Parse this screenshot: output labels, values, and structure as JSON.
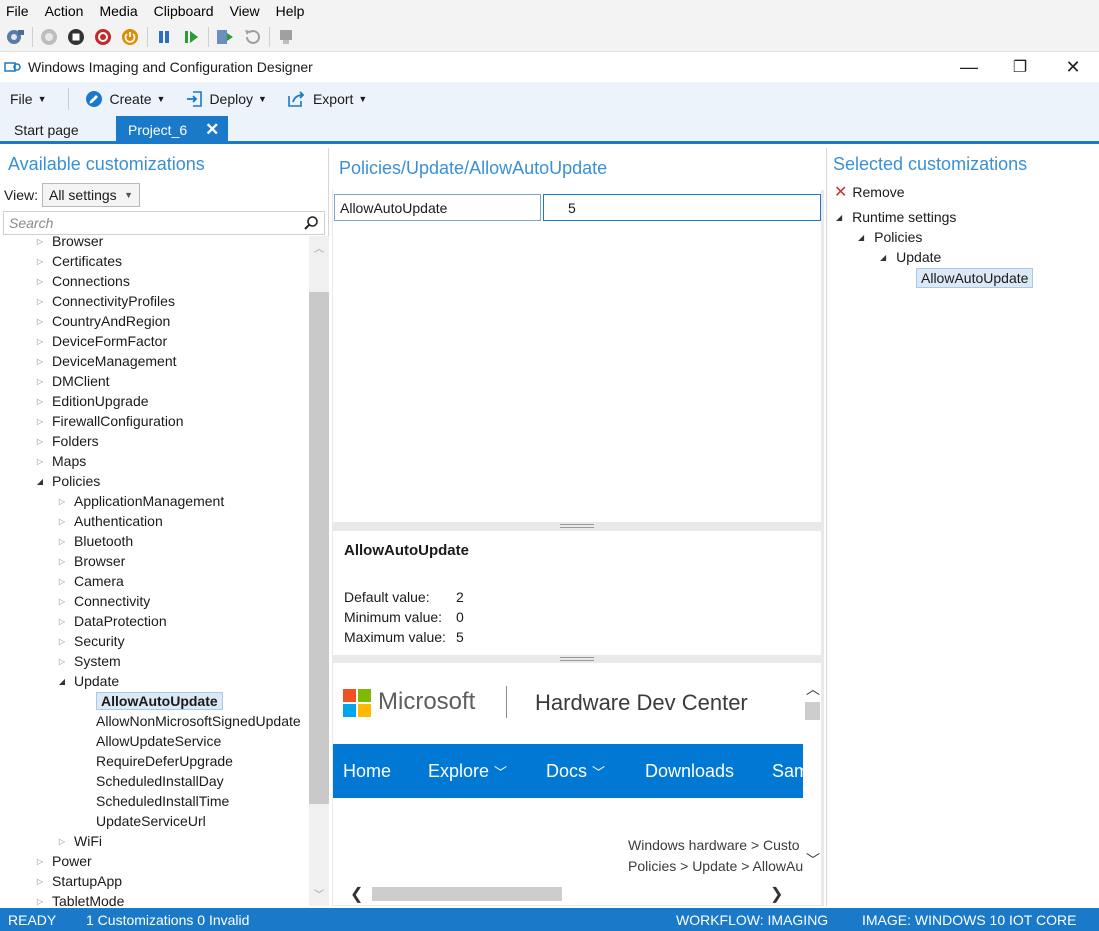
{
  "host": {
    "menu": [
      "File",
      "Action",
      "Media",
      "Clipboard",
      "View",
      "Help"
    ],
    "toolbar_icons": [
      "ctrl-alt-del-icon",
      "start-icon",
      "stop-icon",
      "shutdown-icon",
      "power-icon",
      "pause-icon",
      "resume-icon",
      "checkpoint-icon",
      "revert-icon",
      "enhanced-session-icon"
    ]
  },
  "window": {
    "title": "Windows Imaging and Configuration Designer",
    "controls": {
      "minimize": "—",
      "restore": "❐",
      "close": "✕"
    }
  },
  "commands": {
    "file": "File",
    "create": "Create",
    "deploy": "Deploy",
    "export": "Export"
  },
  "tabs": {
    "start": "Start page",
    "project": "Project_6",
    "close": "✕"
  },
  "left": {
    "title": "Available customizations",
    "view_label": "View:",
    "view_value": "All settings",
    "search_placeholder": "Search",
    "tree": [
      {
        "label": "Browser",
        "level": 0,
        "state": "closed"
      },
      {
        "label": "Certificates",
        "level": 0,
        "state": "closed"
      },
      {
        "label": "Connections",
        "level": 0,
        "state": "closed"
      },
      {
        "label": "ConnectivityProfiles",
        "level": 0,
        "state": "closed"
      },
      {
        "label": "CountryAndRegion",
        "level": 0,
        "state": "closed"
      },
      {
        "label": "DeviceFormFactor",
        "level": 0,
        "state": "closed"
      },
      {
        "label": "DeviceManagement",
        "level": 0,
        "state": "closed"
      },
      {
        "label": "DMClient",
        "level": 0,
        "state": "closed"
      },
      {
        "label": "EditionUpgrade",
        "level": 0,
        "state": "closed"
      },
      {
        "label": "FirewallConfiguration",
        "level": 0,
        "state": "closed"
      },
      {
        "label": "Folders",
        "level": 0,
        "state": "closed"
      },
      {
        "label": "Maps",
        "level": 0,
        "state": "closed"
      },
      {
        "label": "Policies",
        "level": 0,
        "state": "open"
      },
      {
        "label": "ApplicationManagement",
        "level": 1,
        "state": "closed"
      },
      {
        "label": "Authentication",
        "level": 1,
        "state": "closed"
      },
      {
        "label": "Bluetooth",
        "level": 1,
        "state": "closed"
      },
      {
        "label": "Browser",
        "level": 1,
        "state": "closed"
      },
      {
        "label": "Camera",
        "level": 1,
        "state": "closed"
      },
      {
        "label": "Connectivity",
        "level": 1,
        "state": "closed"
      },
      {
        "label": "DataProtection",
        "level": 1,
        "state": "closed"
      },
      {
        "label": "Security",
        "level": 1,
        "state": "closed"
      },
      {
        "label": "System",
        "level": 1,
        "state": "closed"
      },
      {
        "label": "Update",
        "level": 1,
        "state": "open"
      },
      {
        "label": "AllowAutoUpdate",
        "level": 2,
        "state": "leaf",
        "selected": true
      },
      {
        "label": "AllowNonMicrosoftSignedUpdate",
        "level": 2,
        "state": "leaf"
      },
      {
        "label": "AllowUpdateService",
        "level": 2,
        "state": "leaf"
      },
      {
        "label": "RequireDeferUpgrade",
        "level": 2,
        "state": "leaf"
      },
      {
        "label": "ScheduledInstallDay",
        "level": 2,
        "state": "leaf"
      },
      {
        "label": "ScheduledInstallTime",
        "level": 2,
        "state": "leaf"
      },
      {
        "label": "UpdateServiceUrl",
        "level": 2,
        "state": "leaf"
      },
      {
        "label": "WiFi",
        "level": 1,
        "state": "closed"
      },
      {
        "label": "Power",
        "level": 0,
        "state": "closed"
      },
      {
        "label": "StartupApp",
        "level": 0,
        "state": "closed"
      },
      {
        "label": "TabletMode",
        "level": 0,
        "state": "closed"
      }
    ]
  },
  "middle": {
    "title": "Policies/Update/AllowAutoUpdate",
    "setting_name": "AllowAutoUpdate",
    "setting_value": "5",
    "info": {
      "title": "AllowAutoUpdate",
      "default_label": "Default value:",
      "default_value": "2",
      "min_label": "Minimum value:",
      "min_value": "0",
      "max_label": "Maximum value:",
      "max_value": "5"
    },
    "web": {
      "brand": "Microsoft",
      "site": "Hardware Dev Center",
      "nav": [
        "Home",
        "Explore",
        "Docs",
        "Downloads",
        "Sam"
      ],
      "crumb1": "Windows hardware  >  Custo",
      "crumb2": "Policies  >  Update  >  AllowAu"
    }
  },
  "right": {
    "title": "Selected customizations",
    "remove": "Remove",
    "tree": {
      "runtime": "Runtime settings",
      "policies": "Policies",
      "update": "Update",
      "selected": "AllowAutoUpdate"
    }
  },
  "status": {
    "ready": "READY",
    "customizations": "1 Customizations  0 Invalid",
    "workflow": "WORKFLOW: IMAGING",
    "image": "IMAGE: WINDOWS 10 IOT CORE"
  },
  "colors": {
    "accent": "#1b79c9",
    "title_blue": "#3a90d6",
    "ms_nav": "#0078d4",
    "command_bg": "#ecf3fa"
  }
}
